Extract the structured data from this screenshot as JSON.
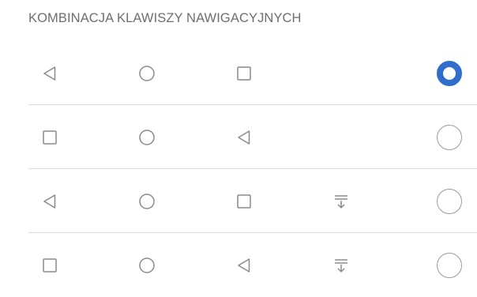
{
  "section": {
    "title": "KOMBINACJA KLAWISZY NAWIGACYJNYCH"
  },
  "colors": {
    "accent": "#2f6ecc",
    "icon": "#8a8a8a",
    "divider": "#dcdcdc",
    "title": "#6e6e6e"
  },
  "options": [
    {
      "keys": [
        "back-icon",
        "home-icon",
        "recents-icon"
      ],
      "selected": true
    },
    {
      "keys": [
        "recents-icon",
        "home-icon",
        "back-icon"
      ],
      "selected": false
    },
    {
      "keys": [
        "back-icon",
        "home-icon",
        "recents-icon",
        "notification-pulldown-icon"
      ],
      "selected": false
    },
    {
      "keys": [
        "recents-icon",
        "home-icon",
        "back-icon",
        "notification-pulldown-icon"
      ],
      "selected": false
    }
  ]
}
